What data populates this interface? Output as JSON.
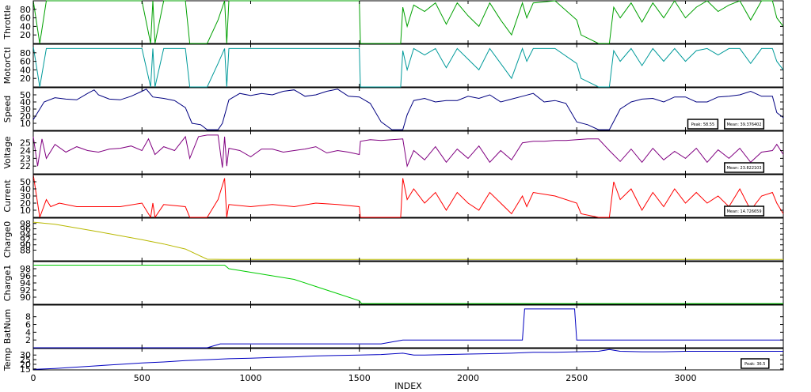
{
  "chart_data": {
    "type": "line",
    "xlabel": "INDEX",
    "xlim": [
      0,
      3450
    ],
    "xticks": [
      0,
      500,
      1000,
      1500,
      2000,
      2500,
      3000
    ],
    "grid": false,
    "panels": [
      {
        "ylabel": "Throttle",
        "color": "#00a000",
        "ylim": [
          0,
          100
        ],
        "yticks": [
          20,
          40,
          60,
          80
        ],
        "x": [
          0,
          30,
          60,
          80,
          120,
          300,
          500,
          540,
          550,
          560,
          600,
          700,
          720,
          790,
          800,
          850,
          880,
          890,
          900,
          1000,
          1200,
          1400,
          1500,
          1505,
          1600,
          1690,
          1700,
          1720,
          1750,
          1800,
          1850,
          1900,
          1950,
          2000,
          2050,
          2100,
          2150,
          2200,
          2250,
          2270,
          2300,
          2400,
          2500,
          2520,
          2600,
          2650,
          2670,
          2700,
          2750,
          2800,
          2850,
          2900,
          2950,
          3000,
          3050,
          3100,
          3150,
          3200,
          3250,
          3300,
          3350,
          3400,
          3420,
          3450
        ],
        "values": [
          100,
          0,
          100,
          100,
          100,
          100,
          100,
          0,
          100,
          0,
          100,
          100,
          0,
          0,
          0,
          55,
          100,
          0,
          100,
          100,
          100,
          100,
          100,
          0,
          0,
          0,
          85,
          40,
          90,
          75,
          95,
          45,
          95,
          65,
          40,
          95,
          55,
          20,
          95,
          60,
          95,
          100,
          55,
          20,
          0,
          0,
          85,
          60,
          95,
          50,
          95,
          60,
          100,
          60,
          85,
          100,
          75,
          90,
          100,
          55,
          100,
          100,
          60,
          40
        ],
        "annotations": []
      },
      {
        "ylabel": "MotorCtl",
        "color": "#009a9a",
        "ylim": [
          0,
          100
        ],
        "yticks": [
          20,
          40,
          60,
          80
        ],
        "x": [
          0,
          30,
          60,
          80,
          120,
          300,
          500,
          540,
          550,
          560,
          600,
          700,
          720,
          790,
          800,
          850,
          880,
          890,
          900,
          1000,
          1200,
          1400,
          1500,
          1505,
          1600,
          1690,
          1700,
          1720,
          1750,
          1800,
          1850,
          1900,
          1950,
          2000,
          2050,
          2100,
          2150,
          2200,
          2250,
          2270,
          2300,
          2400,
          2500,
          2520,
          2600,
          2650,
          2670,
          2700,
          2750,
          2800,
          2850,
          2900,
          2950,
          3000,
          3050,
          3100,
          3150,
          3200,
          3250,
          3300,
          3350,
          3400,
          3420,
          3450
        ],
        "values": [
          95,
          0,
          90,
          90,
          90,
          90,
          90,
          0,
          90,
          0,
          90,
          90,
          0,
          0,
          0,
          55,
          90,
          0,
          90,
          90,
          90,
          90,
          90,
          0,
          0,
          0,
          85,
          40,
          90,
          75,
          90,
          45,
          90,
          65,
          40,
          90,
          55,
          20,
          90,
          60,
          90,
          90,
          55,
          20,
          0,
          0,
          85,
          60,
          90,
          50,
          90,
          60,
          90,
          60,
          85,
          90,
          75,
          90,
          90,
          55,
          90,
          90,
          60,
          40
        ],
        "annotations": []
      },
      {
        "ylabel": "Speed",
        "color": "#000080",
        "ylim": [
          0,
          60
        ],
        "yticks": [
          10,
          20,
          30,
          40,
          50
        ],
        "x": [
          0,
          50,
          100,
          150,
          200,
          250,
          280,
          300,
          350,
          400,
          450,
          500,
          520,
          550,
          600,
          650,
          700,
          730,
          770,
          800,
          850,
          870,
          900,
          950,
          1000,
          1050,
          1100,
          1150,
          1200,
          1250,
          1300,
          1350,
          1400,
          1450,
          1500,
          1550,
          1600,
          1650,
          1700,
          1720,
          1750,
          1800,
          1850,
          1900,
          1950,
          2000,
          2050,
          2100,
          2150,
          2200,
          2250,
          2300,
          2350,
          2400,
          2450,
          2500,
          2550,
          2600,
          2650,
          2700,
          2750,
          2800,
          2850,
          2900,
          2950,
          3000,
          3050,
          3100,
          3150,
          3200,
          3250,
          3300,
          3350,
          3400,
          3420,
          3450
        ],
        "values": [
          15,
          40,
          46,
          44,
          43,
          52,
          57,
          50,
          44,
          43,
          48,
          55,
          58,
          47,
          45,
          42,
          32,
          10,
          8,
          1,
          1,
          10,
          43,
          52,
          49,
          52,
          50,
          55,
          57,
          48,
          50,
          55,
          58,
          48,
          47,
          38,
          12,
          1,
          1,
          22,
          42,
          45,
          40,
          42,
          42,
          48,
          45,
          50,
          40,
          44,
          48,
          52,
          40,
          42,
          38,
          12,
          8,
          1,
          1,
          30,
          40,
          44,
          45,
          40,
          47,
          47,
          40,
          40,
          47,
          48,
          50,
          55,
          48,
          48,
          25,
          18
        ],
        "annotations": [
          {
            "text": "Peak: 58.55",
            "at_x": 3080
          },
          {
            "text": "Mean: 39.376402",
            "at_x": 3270
          }
        ]
      },
      {
        "ylabel": "Voltage",
        "color": "#800080",
        "ylim": [
          21,
          26.5
        ],
        "yticks": [
          22,
          23,
          24,
          25
        ],
        "x": [
          0,
          20,
          40,
          60,
          100,
          150,
          200,
          250,
          300,
          350,
          400,
          450,
          500,
          530,
          560,
          600,
          650,
          700,
          720,
          760,
          800,
          850,
          870,
          880,
          890,
          900,
          950,
          1000,
          1050,
          1100,
          1150,
          1200,
          1250,
          1300,
          1350,
          1400,
          1450,
          1500,
          1505,
          1550,
          1600,
          1650,
          1700,
          1720,
          1750,
          1800,
          1850,
          1900,
          1950,
          2000,
          2050,
          2100,
          2150,
          2200,
          2250,
          2300,
          2350,
          2400,
          2450,
          2500,
          2550,
          2600,
          2650,
          2700,
          2750,
          2800,
          2850,
          2900,
          2950,
          3000,
          3050,
          3100,
          3150,
          3200,
          3250,
          3300,
          3350,
          3400,
          3420,
          3450
        ],
        "values": [
          25.8,
          22,
          25.5,
          23,
          24.8,
          23.8,
          24.5,
          24,
          23.8,
          24.2,
          24.3,
          24.6,
          24,
          25.5,
          23.5,
          24.5,
          24,
          25.8,
          23,
          25.8,
          26,
          26,
          21.8,
          25.8,
          22,
          24.3,
          24,
          23.2,
          24.2,
          24.2,
          23.8,
          24,
          24.2,
          24.5,
          23.7,
          24,
          23.8,
          23.5,
          25.2,
          25.4,
          25.3,
          25.4,
          25.5,
          22,
          24,
          22.8,
          24.5,
          22.5,
          24.2,
          23,
          24.6,
          22.5,
          24,
          22.8,
          25,
          25.2,
          25.2,
          25.3,
          25.3,
          25.4,
          25.5,
          25.5,
          24,
          22.6,
          24.2,
          22.5,
          24.3,
          22.8,
          23.9,
          23,
          24.3,
          22.5,
          24.1,
          23,
          24.3,
          22.5,
          23.8,
          24,
          24.8,
          23.5
        ],
        "annotations": [
          {
            "text": "Mean: 23.822103",
            "at_x": 3270
          }
        ]
      },
      {
        "ylabel": "Current",
        "color": "#ff0000",
        "ylim": [
          0,
          60
        ],
        "yticks": [
          10,
          20,
          30,
          40,
          50
        ],
        "x": [
          0,
          30,
          60,
          80,
          120,
          200,
          300,
          400,
          500,
          540,
          550,
          560,
          600,
          700,
          720,
          790,
          800,
          850,
          880,
          890,
          900,
          1000,
          1100,
          1200,
          1300,
          1400,
          1500,
          1505,
          1600,
          1690,
          1700,
          1720,
          1750,
          1800,
          1850,
          1900,
          1950,
          2000,
          2050,
          2100,
          2150,
          2200,
          2250,
          2270,
          2300,
          2400,
          2500,
          2520,
          2600,
          2650,
          2670,
          2700,
          2750,
          2800,
          2850,
          2900,
          2950,
          3000,
          3050,
          3100,
          3150,
          3200,
          3250,
          3300,
          3350,
          3400,
          3420,
          3450
        ],
        "values": [
          60,
          0,
          25,
          15,
          20,
          15,
          15,
          15,
          20,
          0,
          20,
          0,
          18,
          15,
          0,
          0,
          0,
          25,
          55,
          0,
          18,
          15,
          18,
          15,
          20,
          18,
          15,
          0,
          0,
          0,
          55,
          25,
          40,
          20,
          35,
          10,
          35,
          20,
          10,
          35,
          20,
          5,
          30,
          15,
          35,
          30,
          20,
          5,
          0,
          0,
          50,
          25,
          40,
          10,
          35,
          15,
          40,
          20,
          35,
          20,
          30,
          15,
          40,
          10,
          30,
          35,
          20,
          5
        ],
        "annotations": [
          {
            "text": "Mean: 14.726659",
            "at_x": 3270
          }
        ]
      },
      {
        "ylabel": "Charge0",
        "color": "#b8b800",
        "ylim": [
          84,
          100
        ],
        "yticks": [
          88,
          90,
          92,
          94,
          96,
          98
        ],
        "x": [
          0,
          100,
          200,
          300,
          400,
          500,
          600,
          700,
          800,
          880,
          900,
          1000,
          1500,
          2000,
          2500,
          3000,
          3450
        ],
        "values": [
          98.5,
          97.7,
          96.3,
          94.9,
          93.4,
          91.9,
          90.3,
          88.4,
          84.6,
          84.5,
          84.5,
          84.5,
          84.5,
          84.5,
          84.5,
          84.5,
          84.5
        ],
        "annotations": []
      },
      {
        "ylabel": "Charge1",
        "color": "#00cc00",
        "ylim": [
          88,
          100
        ],
        "yticks": [
          90,
          92,
          94,
          96,
          98
        ],
        "x": [
          0,
          500,
          880,
          900,
          1000,
          1100,
          1200,
          1300,
          1400,
          1500,
          1510,
          1600,
          2000,
          2500,
          3000,
          3450
        ],
        "values": [
          99,
          99,
          99,
          98,
          97,
          96,
          95,
          93,
          91,
          89,
          88.2,
          88.2,
          88.2,
          88.2,
          88.2,
          88.2
        ],
        "annotations": []
      },
      {
        "ylabel": "BatNum",
        "color": "#0000c0",
        "ylim": [
          0,
          11
        ],
        "yticks": [
          2,
          4,
          6,
          8
        ],
        "x": [
          0,
          800,
          860,
          1600,
          1700,
          2250,
          2260,
          2490,
          2500,
          3450
        ],
        "values": [
          0,
          0,
          1,
          1,
          2,
          2,
          10,
          10,
          2,
          2
        ],
        "annotations": []
      },
      {
        "ylabel": "Temp",
        "color": "#0000c0",
        "ylim": [
          14,
          37
        ],
        "yticks": [
          15,
          20,
          25,
          30
        ],
        "x": [
          0,
          100,
          200,
          300,
          400,
          500,
          600,
          700,
          800,
          900,
          1000,
          1100,
          1200,
          1300,
          1400,
          1500,
          1600,
          1700,
          1750,
          1800,
          1900,
          2000,
          2100,
          2200,
          2300,
          2400,
          2500,
          2600,
          2650,
          2700,
          2800,
          2900,
          3000,
          3100,
          3200,
          3300,
          3400,
          3450
        ],
        "values": [
          14.5,
          15.5,
          17,
          18.5,
          20,
          21.5,
          22.5,
          24,
          25,
          26,
          26.5,
          27.5,
          28,
          29,
          29.5,
          30,
          30.5,
          32,
          30,
          30,
          30.5,
          31,
          31.5,
          32,
          33,
          33,
          33.5,
          34,
          36,
          34,
          33.5,
          33.5,
          34,
          34,
          34,
          34,
          34,
          34
        ],
        "annotations": [
          {
            "text": "Peak: 36.5",
            "at_x": 3320
          }
        ]
      }
    ]
  }
}
